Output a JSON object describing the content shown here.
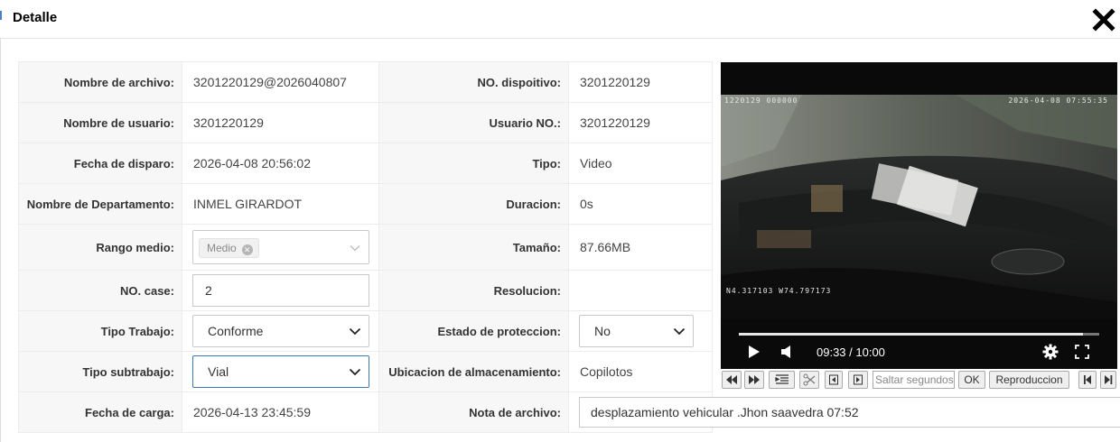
{
  "dialog": {
    "title": "Detalle",
    "close_icon": "close-icon"
  },
  "form": {
    "file_name_label": "Nombre de archivo:",
    "file_name": "3201220129@2026040807",
    "device_no_label": "NO. dispoitivo:",
    "device_no": "3201220129",
    "user_name_label": "Nombre de usuario:",
    "user_name": "3201220129",
    "user_no_label": "Usuario NO.:",
    "user_no": "3201220129",
    "shot_date_label": "Fecha de disparo:",
    "shot_date": "2026-04-08 20:56:02",
    "type_label": "Tipo:",
    "type": "Video",
    "department_label": "Nombre de Departamento:",
    "department": "INMEL GIRARDOT",
    "duration_label": "Duracion:",
    "duration": "0s",
    "range_label": "Rango medio:",
    "range_tag": "Medio",
    "size_label": "Tamaño:",
    "size": "87.66MB",
    "case_label": "NO. case:",
    "case_value": "2",
    "resolution_label": "Resolucion:",
    "resolution": "",
    "work_type_label": "Tipo Trabajo:",
    "work_type": "Conforme",
    "protection_label": "Estado de proteccion:",
    "protection": "No",
    "subwork_label": "Tipo subtrabajo:",
    "subwork": "Vial",
    "storage_label": "Ubicacion de almacenamiento:",
    "storage": "Copilotos",
    "upload_date_label": "Fecha de carga:",
    "upload_date": "2026-04-13 23:45:59",
    "note_label": "Nota de archivo:",
    "note": "desplazamiento vehicular .Jhon saavedra 07:52"
  },
  "player": {
    "osd_top_left": "1220129 000000",
    "osd_top_right": "2026-04-08 07:55:35",
    "osd_gps": "N4.317103 W74.797173",
    "time": "09:33 / 10:00",
    "progress": 0.955,
    "toolbar": {
      "seek_placeholder": "Saltar segundos",
      "ok_label": "OK",
      "playback_label": "Reproduccion"
    }
  }
}
